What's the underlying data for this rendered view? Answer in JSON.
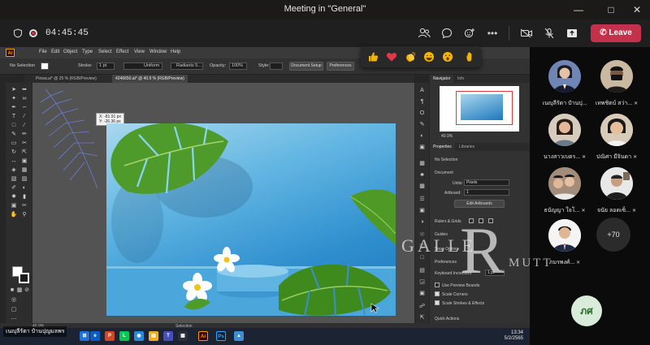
{
  "window": {
    "title": "Meeting in \"General\""
  },
  "meeting_toolbar": {
    "timer": "04:45:45",
    "leave_label": "Leave",
    "colors": {
      "leave": "#c4314b"
    }
  },
  "reactions": [
    "like-icon",
    "heart-icon",
    "clap-icon",
    "laugh-icon",
    "surprised-icon",
    "raise-hand-icon"
  ],
  "illustrator": {
    "logo": "Ai",
    "menu": [
      "File",
      "Edit",
      "Object",
      "Type",
      "Select",
      "Effect",
      "View",
      "Window",
      "Help"
    ],
    "options": {
      "selection": "No Selection",
      "stroke_label": "Stroke:",
      "stroke_value": "1 pt",
      "stroke_style": "Uniform",
      "brush": "Radiants 5...",
      "opacity_label": "Opacity:",
      "opacity_value": "100%",
      "style_label": "Style:",
      "doc_setup": "Document Setup",
      "preferences": "Preferences"
    },
    "tabs": [
      {
        "label": "Pinwa.ai* @ 25 % (RGB/Preview)",
        "active": false
      },
      {
        "label": "4246650.ai* @ 40.9 % (RGB/Preview)",
        "active": true
      }
    ],
    "coord_tip": {
      "x": "X: -81.91 px",
      "y": "Y: -26.36 px"
    },
    "status": {
      "zoom": "40.9%",
      "mode": "Selection"
    },
    "panels": {
      "tabs": [
        "Navigator",
        "Info"
      ],
      "zoom": "40.9%",
      "props_tabs": [
        "Properties",
        "Libraries"
      ],
      "no_selection": "No Selection",
      "document": "Document",
      "units_label": "Units:",
      "units_value": "Pixels",
      "artboard_label": "Artboard:",
      "artboard_value": "1",
      "edit_artboards": "Edit Artboards",
      "rulers": "Rulers & Grids",
      "guides": "Guides",
      "snap": "Snap Options",
      "preferences": "Preferences",
      "keyboard": "Keyboard Increment",
      "keyboard_value": "1 pt",
      "use_preview": "Use Preview Bounds",
      "scale_corners": "Scale Corners",
      "scale_strokes": "Scale Strokes & Effects",
      "quick_actions": "Quick Actions"
    }
  },
  "taskbar": {
    "presenter": "เนญุลีรัตา ปำนปุญมลพร",
    "time": "13:34",
    "date": "5/2/2565"
  },
  "watermark": {
    "big": "R",
    "left": "GALLE",
    "right": "MUTT"
  },
  "participants": [
    {
      "name": "เนญุลีรัตา ปำนปุ...",
      "muted": false
    },
    {
      "name": "เทพชิตบ์ สว่า...",
      "muted": true
    },
    {
      "name": "นางสาวเบตร...",
      "muted": true
    },
    {
      "name": "ปณิศา มีจินดา",
      "muted": true
    },
    {
      "name": "ธนัญญา ใจโ...",
      "muted": true
    },
    {
      "name": "จนัย ลอดเซ็...",
      "muted": true
    },
    {
      "name": "ภมรพงศ์...",
      "muted": true
    }
  ],
  "more_count": "+70",
  "self_initials": "ภศ"
}
